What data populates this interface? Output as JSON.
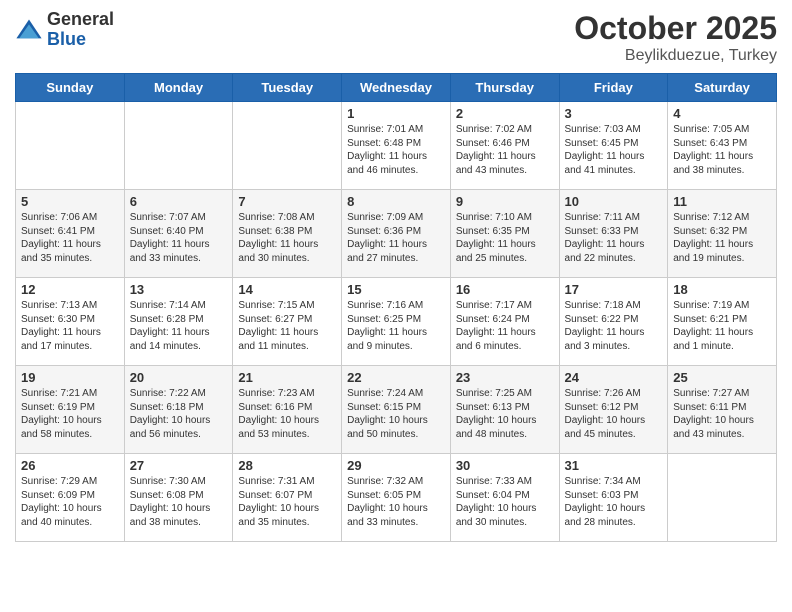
{
  "header": {
    "logo_general": "General",
    "logo_blue": "Blue",
    "month_year": "October 2025",
    "location": "Beylikduezue, Turkey"
  },
  "days_of_week": [
    "Sunday",
    "Monday",
    "Tuesday",
    "Wednesday",
    "Thursday",
    "Friday",
    "Saturday"
  ],
  "weeks": [
    [
      {
        "day": "",
        "text": ""
      },
      {
        "day": "",
        "text": ""
      },
      {
        "day": "",
        "text": ""
      },
      {
        "day": "1",
        "text": "Sunrise: 7:01 AM\nSunset: 6:48 PM\nDaylight: 11 hours\nand 46 minutes."
      },
      {
        "day": "2",
        "text": "Sunrise: 7:02 AM\nSunset: 6:46 PM\nDaylight: 11 hours\nand 43 minutes."
      },
      {
        "day": "3",
        "text": "Sunrise: 7:03 AM\nSunset: 6:45 PM\nDaylight: 11 hours\nand 41 minutes."
      },
      {
        "day": "4",
        "text": "Sunrise: 7:05 AM\nSunset: 6:43 PM\nDaylight: 11 hours\nand 38 minutes."
      }
    ],
    [
      {
        "day": "5",
        "text": "Sunrise: 7:06 AM\nSunset: 6:41 PM\nDaylight: 11 hours\nand 35 minutes."
      },
      {
        "day": "6",
        "text": "Sunrise: 7:07 AM\nSunset: 6:40 PM\nDaylight: 11 hours\nand 33 minutes."
      },
      {
        "day": "7",
        "text": "Sunrise: 7:08 AM\nSunset: 6:38 PM\nDaylight: 11 hours\nand 30 minutes."
      },
      {
        "day": "8",
        "text": "Sunrise: 7:09 AM\nSunset: 6:36 PM\nDaylight: 11 hours\nand 27 minutes."
      },
      {
        "day": "9",
        "text": "Sunrise: 7:10 AM\nSunset: 6:35 PM\nDaylight: 11 hours\nand 25 minutes."
      },
      {
        "day": "10",
        "text": "Sunrise: 7:11 AM\nSunset: 6:33 PM\nDaylight: 11 hours\nand 22 minutes."
      },
      {
        "day": "11",
        "text": "Sunrise: 7:12 AM\nSunset: 6:32 PM\nDaylight: 11 hours\nand 19 minutes."
      }
    ],
    [
      {
        "day": "12",
        "text": "Sunrise: 7:13 AM\nSunset: 6:30 PM\nDaylight: 11 hours\nand 17 minutes."
      },
      {
        "day": "13",
        "text": "Sunrise: 7:14 AM\nSunset: 6:28 PM\nDaylight: 11 hours\nand 14 minutes."
      },
      {
        "day": "14",
        "text": "Sunrise: 7:15 AM\nSunset: 6:27 PM\nDaylight: 11 hours\nand 11 minutes."
      },
      {
        "day": "15",
        "text": "Sunrise: 7:16 AM\nSunset: 6:25 PM\nDaylight: 11 hours\nand 9 minutes."
      },
      {
        "day": "16",
        "text": "Sunrise: 7:17 AM\nSunset: 6:24 PM\nDaylight: 11 hours\nand 6 minutes."
      },
      {
        "day": "17",
        "text": "Sunrise: 7:18 AM\nSunset: 6:22 PM\nDaylight: 11 hours\nand 3 minutes."
      },
      {
        "day": "18",
        "text": "Sunrise: 7:19 AM\nSunset: 6:21 PM\nDaylight: 11 hours\nand 1 minute."
      }
    ],
    [
      {
        "day": "19",
        "text": "Sunrise: 7:21 AM\nSunset: 6:19 PM\nDaylight: 10 hours\nand 58 minutes."
      },
      {
        "day": "20",
        "text": "Sunrise: 7:22 AM\nSunset: 6:18 PM\nDaylight: 10 hours\nand 56 minutes."
      },
      {
        "day": "21",
        "text": "Sunrise: 7:23 AM\nSunset: 6:16 PM\nDaylight: 10 hours\nand 53 minutes."
      },
      {
        "day": "22",
        "text": "Sunrise: 7:24 AM\nSunset: 6:15 PM\nDaylight: 10 hours\nand 50 minutes."
      },
      {
        "day": "23",
        "text": "Sunrise: 7:25 AM\nSunset: 6:13 PM\nDaylight: 10 hours\nand 48 minutes."
      },
      {
        "day": "24",
        "text": "Sunrise: 7:26 AM\nSunset: 6:12 PM\nDaylight: 10 hours\nand 45 minutes."
      },
      {
        "day": "25",
        "text": "Sunrise: 7:27 AM\nSunset: 6:11 PM\nDaylight: 10 hours\nand 43 minutes."
      }
    ],
    [
      {
        "day": "26",
        "text": "Sunrise: 7:29 AM\nSunset: 6:09 PM\nDaylight: 10 hours\nand 40 minutes."
      },
      {
        "day": "27",
        "text": "Sunrise: 7:30 AM\nSunset: 6:08 PM\nDaylight: 10 hours\nand 38 minutes."
      },
      {
        "day": "28",
        "text": "Sunrise: 7:31 AM\nSunset: 6:07 PM\nDaylight: 10 hours\nand 35 minutes."
      },
      {
        "day": "29",
        "text": "Sunrise: 7:32 AM\nSunset: 6:05 PM\nDaylight: 10 hours\nand 33 minutes."
      },
      {
        "day": "30",
        "text": "Sunrise: 7:33 AM\nSunset: 6:04 PM\nDaylight: 10 hours\nand 30 minutes."
      },
      {
        "day": "31",
        "text": "Sunrise: 7:34 AM\nSunset: 6:03 PM\nDaylight: 10 hours\nand 28 minutes."
      },
      {
        "day": "",
        "text": ""
      }
    ]
  ],
  "alt_rows": [
    1,
    3
  ]
}
